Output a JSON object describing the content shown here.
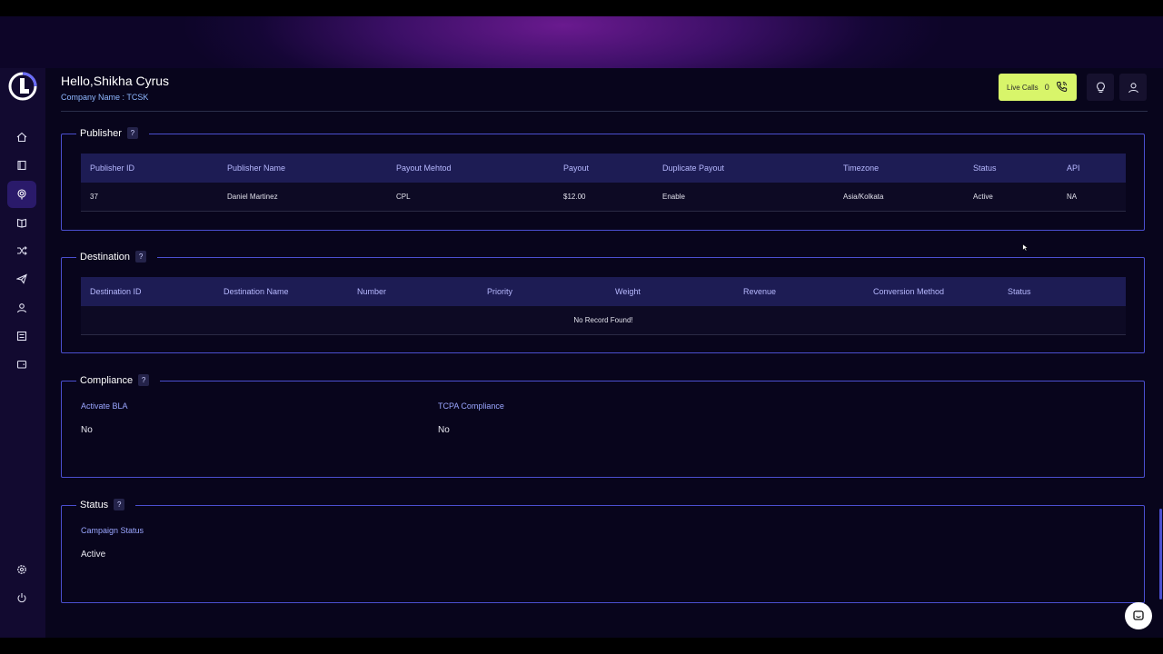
{
  "header": {
    "greeting": "Hello,Shikha Cyrus",
    "company_label": "Company Name : ",
    "company_value": "TCSK"
  },
  "live_calls": {
    "label": "Live Calls",
    "count": "0"
  },
  "publisher": {
    "title": "Publisher",
    "help": "?",
    "columns": [
      "Publisher ID",
      "Publisher Name",
      "Payout Mehtod",
      "Payout",
      "Duplicate Payout",
      "Timezone",
      "Status",
      "API"
    ],
    "rows": [
      [
        "37",
        "Daniel Martinez",
        "CPL",
        "$12.00",
        "Enable",
        "Asia/Kolkata",
        "Active",
        "NA"
      ]
    ]
  },
  "destination": {
    "title": "Destination",
    "help": "?",
    "columns": [
      "Destination ID",
      "Destination Name",
      "Number",
      "Priority",
      "Weight",
      "Revenue",
      "Conversion Method",
      "Status"
    ],
    "empty": "No Record Found!"
  },
  "compliance": {
    "title": "Compliance",
    "help": "?",
    "bla_label": "Activate BLA",
    "bla_value": "No",
    "tcpa_label": "TCPA Compliance",
    "tcpa_value": "No"
  },
  "status": {
    "title": "Status",
    "help": "?",
    "campaign_label": "Campaign Status",
    "campaign_value": "Active"
  },
  "colors": {
    "accent_border": "#4b4fd0",
    "live_button": "#d8f56a",
    "table_header": "#1d1c54",
    "label_blue": "#9aa6ff"
  },
  "sidebar_icons": [
    "home-icon",
    "book-icon",
    "campaign-icon",
    "publisher-icon",
    "shuffle-icon",
    "send-icon",
    "user-icon",
    "report-icon",
    "wallet-icon",
    "settings-icon",
    "power-icon"
  ]
}
